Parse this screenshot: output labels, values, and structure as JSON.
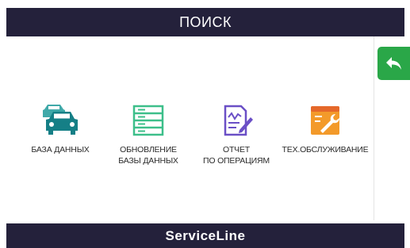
{
  "header": {
    "title": "ПОИСК"
  },
  "menu": {
    "items": [
      {
        "label": "БАЗА ДАННЫХ",
        "icon": "cars-icon"
      },
      {
        "label": "ОБНОВЛЕНИЕ\nБАЗЫ ДАННЫХ",
        "icon": "database-update-icon"
      },
      {
        "label": "ОТЧЕТ\nПО ОПЕРАЦИЯМ",
        "icon": "report-icon"
      },
      {
        "label": "ТЕХ.ОБСЛУЖИВАНИЕ",
        "icon": "maintenance-icon"
      }
    ]
  },
  "back_button": {
    "icon": "back-arrow-icon"
  },
  "footer": {
    "brand": "ServiceLine"
  },
  "colors": {
    "bar": "#24213b",
    "accent_green": "#2aa748",
    "teal": "#1e9a9a",
    "db_green": "#3dbf8a",
    "report_purple": "#6a4fc6",
    "wrench_orange": "#f08a24"
  }
}
